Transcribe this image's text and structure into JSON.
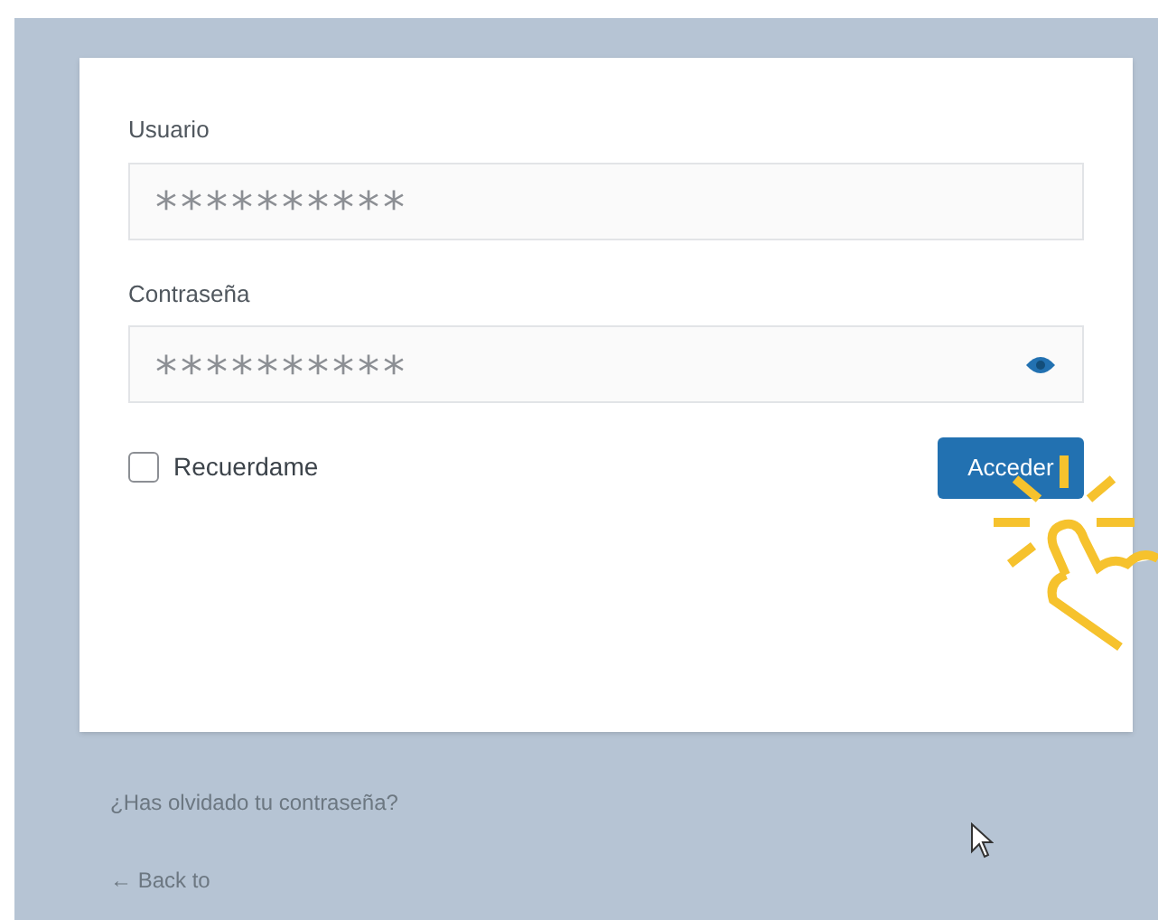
{
  "login_form": {
    "username": {
      "label": "Usuario",
      "value": "**********"
    },
    "password": {
      "label": "Contraseña",
      "value": "**********"
    },
    "remember": {
      "label": "Recuerdame",
      "checked": false
    },
    "submit": {
      "label": "Acceder"
    }
  },
  "links": [
    {
      "text": "¿Has olvidado tu contraseña?"
    },
    {
      "text": "← Back to"
    }
  ]
}
